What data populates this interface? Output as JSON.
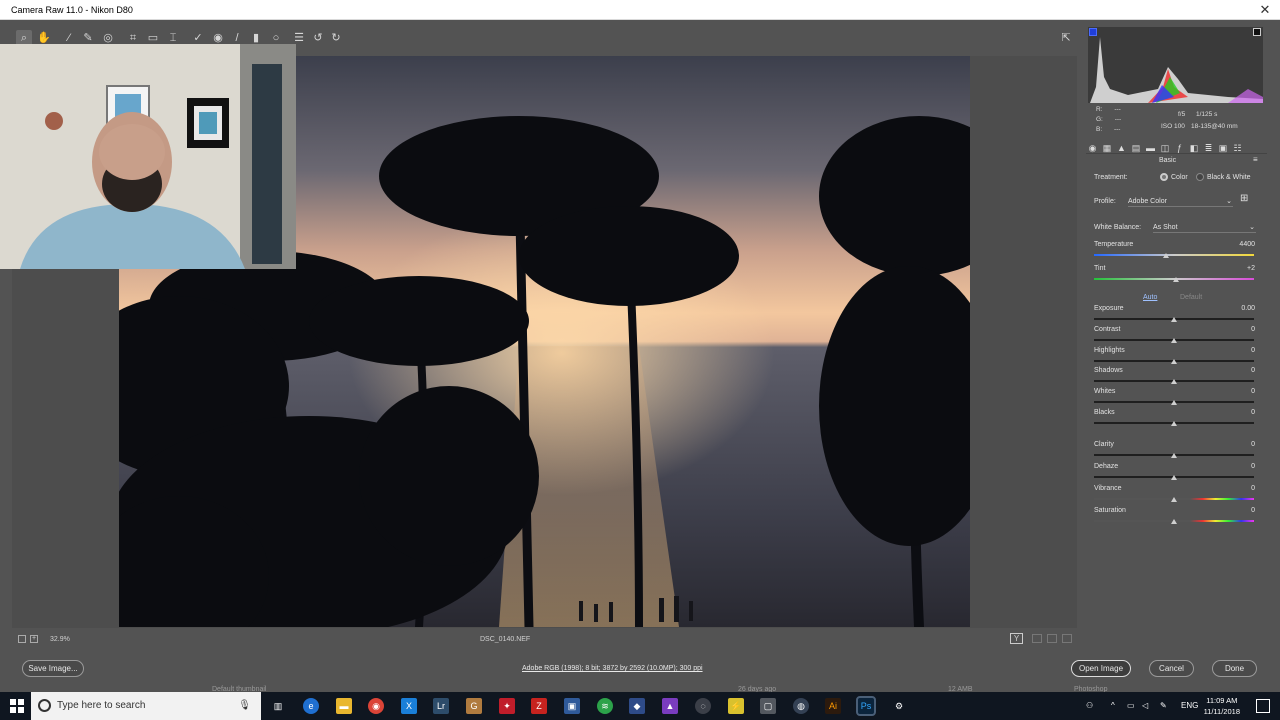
{
  "window": {
    "title": "Camera Raw 11.0  -  Nikon D80",
    "close_icon": "close-icon"
  },
  "toolbar": {
    "tools": [
      "zoom-icon",
      "hand-icon",
      "white-balance-icon",
      "color-sampler-icon",
      "target-adjust-icon",
      "crop-icon",
      "straighten-icon",
      "transform-icon",
      "spot-removal-icon",
      "red-eye-icon",
      "adjustment-brush-icon",
      "graduated-filter-icon",
      "radial-filter-icon",
      "preferences-icon",
      "rotate-left-icon",
      "rotate-right-icon"
    ],
    "fullscreen": "fullscreen-icon"
  },
  "status": {
    "zoom": "32.9%",
    "filename": "DSC_0140.NEF"
  },
  "bottom": {
    "save_label": "Save Image...",
    "info": "Adobe RGB (1998); 8 bit; 3872 by 2592 (10.0MP); 300 ppi",
    "open_label": "Open Image",
    "cancel_label": "Cancel",
    "done_label": "Done"
  },
  "ghost_labels": {
    "left": "Default thumbnail",
    "mid": "26 days ago",
    "right1": "12 AMB",
    "right2": "Photoshop"
  },
  "histogram": {
    "r": "R:",
    "g": "G:",
    "b": "B:",
    "dash": "---",
    "aperture": "f/5",
    "shutter": "1/125 s",
    "iso": "ISO 100",
    "lens": "18-135@40 mm"
  },
  "panel": {
    "section": "Basic",
    "treatment_label": "Treatment:",
    "treatment_color": "Color",
    "treatment_bw": "Black & White",
    "profile_label": "Profile:",
    "profile_value": "Adobe Color",
    "wb_label": "White Balance:",
    "wb_value": "As Shot",
    "auto": "Auto",
    "default": "Default",
    "sliders": [
      {
        "name": "Temperature",
        "value": "4400",
        "pos": 0.45
      },
      {
        "name": "Tint",
        "value": "+2",
        "pos": 0.51
      },
      {
        "name": "Exposure",
        "value": "0.00",
        "pos": 0.5
      },
      {
        "name": "Contrast",
        "value": "0",
        "pos": 0.5
      },
      {
        "name": "Highlights",
        "value": "0",
        "pos": 0.5
      },
      {
        "name": "Shadows",
        "value": "0",
        "pos": 0.5
      },
      {
        "name": "Whites",
        "value": "0",
        "pos": 0.5
      },
      {
        "name": "Blacks",
        "value": "0",
        "pos": 0.5
      },
      {
        "name": "Clarity",
        "value": "0",
        "pos": 0.5
      },
      {
        "name": "Dehaze",
        "value": "0",
        "pos": 0.5
      },
      {
        "name": "Vibrance",
        "value": "0",
        "pos": 0.5
      },
      {
        "name": "Saturation",
        "value": "0",
        "pos": 0.5
      }
    ]
  },
  "taskbar": {
    "search_placeholder": "Type here to search",
    "lang": "ENG",
    "time": "11:09 AM",
    "date": "11/11/2018"
  }
}
